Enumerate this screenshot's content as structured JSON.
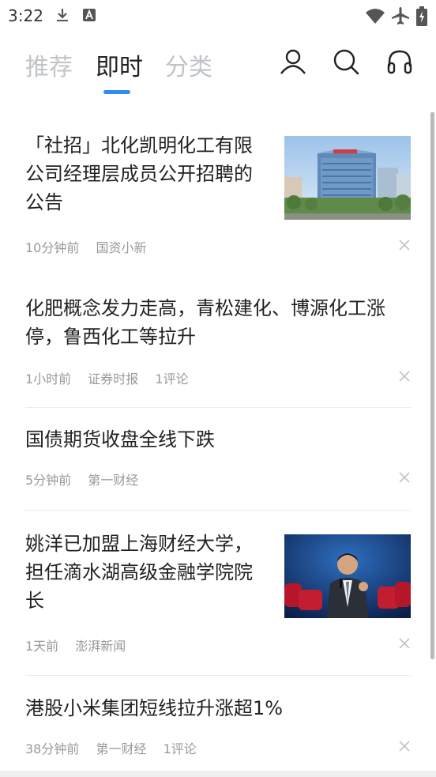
{
  "status_bar": {
    "time": "3:22"
  },
  "nav": {
    "tabs": [
      {
        "label": "推荐",
        "active": false
      },
      {
        "label": "即时",
        "active": true
      },
      {
        "label": "分类",
        "active": false
      }
    ],
    "icons": [
      "user-icon",
      "search-icon",
      "headphones-icon"
    ],
    "accent_color": "#2e8df0"
  },
  "feed": {
    "items": [
      {
        "title_lines": [
          "「社招」北化凯明化工有限",
          "公司经理层成员公开招聘的",
          "公告"
        ],
        "meta": [
          "10分钟前",
          "国资小新"
        ],
        "has_image": true,
        "image": "office-building-photo"
      },
      {
        "title_lines": [
          "化肥概念发力走高，青松建化、博源化工涨",
          "停，鲁西化工等拉升"
        ],
        "meta": [
          "1小时前",
          "证券时报",
          "1评论"
        ],
        "has_image": false
      },
      {
        "title_lines": [
          "国债期货收盘全线下跌"
        ],
        "meta": [
          "5分钟前",
          "第一财经"
        ],
        "has_image": false
      },
      {
        "title_lines": [
          "姚洋已加盟上海财经大学，",
          "担任滴水湖高级金融学院院",
          "长"
        ],
        "meta": [
          "1天前",
          "澎湃新闻"
        ],
        "has_image": true,
        "image": "speaker-on-stage-photo"
      },
      {
        "title_lines": [
          "港股小米集团短线拉升涨超1%"
        ],
        "meta": [
          "38分钟前",
          "第一财经",
          "1评论"
        ],
        "has_image": false
      }
    ]
  }
}
